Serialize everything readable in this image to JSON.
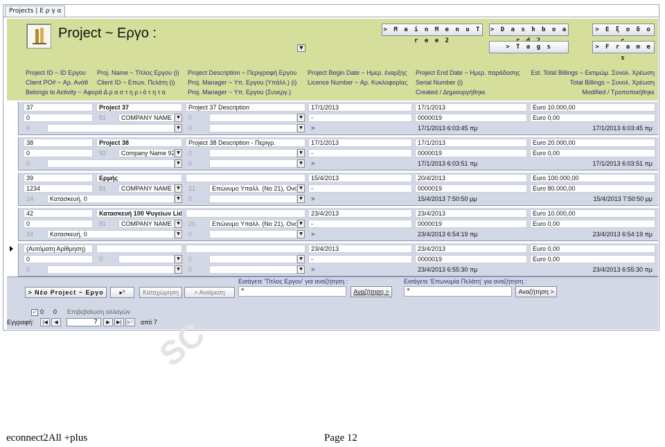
{
  "window": {
    "tab_title": "Projects | Ε ρ γ α"
  },
  "header": {
    "title": "Project ~ Εργο :",
    "buttons": {
      "main_menu": "> M a i n  M e n u  T r e e  2",
      "dashboard": "> D a s h b o a r d 2",
      "exodos": "> Ε ξ ο δ ο ς",
      "tags": "> T a g s",
      "frames": "> F r a m e s"
    },
    "columns": [
      [
        "Project ID ~ ID Εργου",
        "Client PO# ~ Αρ. Ανάθ",
        "Belongs to Activity ~ Αφορά  Δ ρ α σ τ η ρ ι ό τ η τ α"
      ],
      [
        "Proj. Name ~ Τίτλος Εργου (i)",
        "Client ID ~ Επων. Πελάτη (i)",
        ""
      ],
      [
        "Project Description ~ Περιγραφή Εργου",
        "Proj. Manager ~ Υπ. Εργου (Υπάλλ.) (i)",
        "Proj. Manager ~ Υπ. Εργου (Συνεργ.)"
      ],
      [
        "Project Begin Date ~ Ημερ. έναρξης",
        "Licence Number ~ Αρ. Κυκλοφορίας",
        ""
      ],
      [
        "Project End Date ~ Ημερ. παράδοσης",
        "Serial Number (i)",
        "Created / Δημιουργήθηκε"
      ],
      [
        "Est. Total Billings ~ Εκτιμώμ. Συνολ. Χρέωση",
        "Total Billings ~ Συνολ. Χρέωση",
        "Modified / Τροποποιήθηκε"
      ]
    ]
  },
  "records": [
    {
      "id": "37",
      "name": "Project 37",
      "desc": "Project 37 Description",
      "begin": "17/1/2013",
      "end": "17/1/2013",
      "est": "Euro 10.000,00",
      "po": "0",
      "client_id": "81",
      "client": "COMPANY NAME 1",
      "mgr_id": "0",
      "mgr": "",
      "licence": "-",
      "serial": "0000019",
      "total": "Euro 0,00",
      "act_id": "0",
      "activity": "",
      "mgr2_id": "0",
      "mgr2": "",
      "licence2": ">",
      "created": "17/1/2013 6:03:45 πμ",
      "modified": "17/1/2013 6:03:45 πμ"
    },
    {
      "id": "38",
      "name": "Project 38",
      "desc": "Project 38 Description - Περιγρ.",
      "begin": "17/1/2013",
      "end": "17/1/2013",
      "est": "Euro 20.000,00",
      "po": "0",
      "client_id": "92",
      "client": "Company Name 92",
      "mgr_id": "0",
      "mgr": "",
      "licence": "-",
      "serial": "0000019",
      "total": "Euro 0,00",
      "act_id": "0",
      "activity": "",
      "mgr2_id": "0",
      "mgr2": "",
      "licence2": ">",
      "created": "17/1/2013 6:03:51 πμ",
      "modified": "17/1/2013 6:03:51 πμ"
    },
    {
      "id": "39",
      "name": "Ερμής",
      "desc": "",
      "begin": "15/4/2013",
      "end": "20/4/2013",
      "est": "Euro 100.000,00",
      "po": "1234",
      "client_id": "81",
      "client": "COMPANY NAME 1",
      "mgr_id": "21",
      "mgr": "Επώνυμο Υπαλλ. (No 21), Ονομ.",
      "licence": "-",
      "serial": "0000019",
      "total": "Euro 80.000,00",
      "act_id": "24",
      "activity": "Κατασκευή, 0",
      "mgr2_id": "0",
      "mgr2": "",
      "licence2": ">",
      "created": "15/4/2013 7:50:50 μμ",
      "modified": "15/4/2013 7:50:50 μμ"
    },
    {
      "id": "42",
      "name": "Κατασκευή 100 Ψυγείων Lidl",
      "desc": "",
      "begin": "23/4/2013",
      "end": "23/4/2013",
      "est": "Euro 10.000,00",
      "po": "0",
      "client_id": "81",
      "client": "COMPANY NAME 1",
      "mgr_id": "21",
      "mgr": "Επώνυμο Υπαλλ. (No 21), Ονομ.",
      "licence": "-",
      "serial": "0000019",
      "total": "Euro 0,00",
      "act_id": "24",
      "activity": "Κατασκευή, 0",
      "mgr2_id": "0",
      "mgr2": "",
      "licence2": ">",
      "created": "23/4/2013 6:54:19 πμ",
      "modified": "23/4/2013 6:54:19 πμ"
    },
    {
      "id": "(Αυτόματη Αρίθμηση)",
      "name": "",
      "desc": "",
      "begin": "23/4/2013",
      "end": "23/4/2013",
      "est": "Euro 0,00",
      "po": "0",
      "client_id": "0",
      "client": "",
      "mgr_id": "0",
      "mgr": "",
      "licence": "-",
      "serial": "0000019",
      "total": "Euro 0,00",
      "act_id": "0",
      "activity": "",
      "mgr2_id": "0",
      "mgr2": "",
      "licence2": ">",
      "created": "23/4/2013 6:55:30 πμ",
      "modified": "23/4/2013 6:55:30 πμ"
    }
  ],
  "footer": {
    "new_project": "> Νέο Project ~ Εργο",
    "goto_new": "▸*",
    "save": "Καταχώρηση",
    "undo": "> Αναίρεση",
    "confirm_value_1": "0",
    "confirm_value_2": "0",
    "confirm_label": "Επιβεβαίωση αλλαγών",
    "search_title_label": "Εισάγετε 'Τίτλος Εργου' για αναζήτηση :",
    "search_title_value": "*",
    "search_title_btn": "Αναζήτηση >",
    "search_client_label": "Εισάγετε 'Επωνυμία Πελάτη' για αναζήτηση :",
    "search_client_value": "*",
    "search_client_btn": "Αναζήτηση >"
  },
  "navigation": {
    "label": "Εγγραφή:",
    "current": "7",
    "of_label": "από 7"
  },
  "watermark": "SC",
  "page_footer": {
    "left": "econnect2All  +plus",
    "right": "Page 12"
  }
}
